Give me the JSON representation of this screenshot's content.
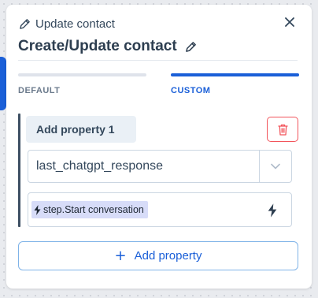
{
  "header": {
    "subtitle": "Update contact",
    "title": "Create/Update contact"
  },
  "tabs": [
    {
      "label": "DEFAULT",
      "active": false
    },
    {
      "label": "CUSTOM",
      "active": true
    }
  ],
  "property": {
    "name": "Add property 1",
    "field": "last_chatgpt_response",
    "value_token": "step.Start conversation"
  },
  "actions": {
    "add_property": "Add property"
  },
  "colors": {
    "accent": "#1a5fd8",
    "danger": "#f2545b",
    "token_bg": "#d7dcf8"
  },
  "icons": [
    "pencil-icon",
    "close-icon",
    "trash-icon",
    "chevron-down-icon",
    "lightning-icon",
    "plus-icon"
  ]
}
